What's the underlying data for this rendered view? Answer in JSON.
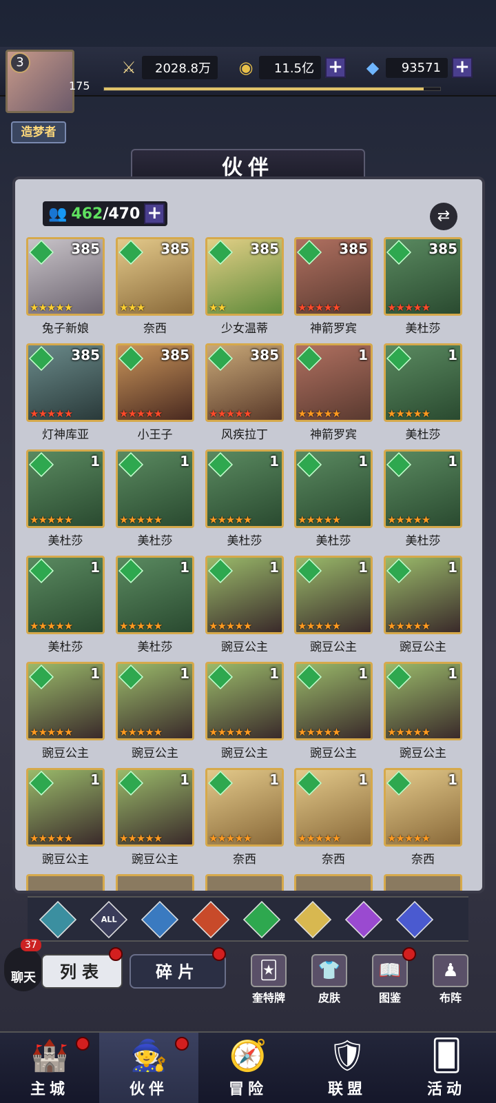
{
  "player": {
    "level": "3",
    "exp": "175",
    "exp_progress": 0.95,
    "title": "造梦者"
  },
  "resources": [
    {
      "icon": "sword-icon",
      "value": "2028.8万"
    },
    {
      "icon": "gold-coin-icon",
      "value": "11.5亿"
    },
    {
      "icon": "diamond-icon",
      "value": "93571"
    }
  ],
  "page_title": "伙伴",
  "partner_count": {
    "current": "462",
    "max": "/470"
  },
  "heroes": [
    {
      "name": "兔子新娘",
      "level": "385",
      "stars": 5,
      "star_color": "gold"
    },
    {
      "name": "奈西",
      "level": "385",
      "stars": 3,
      "star_color": "gold"
    },
    {
      "name": "少女温蒂",
      "level": "385",
      "stars": 2,
      "star_color": "gold"
    },
    {
      "name": "神箭罗宾",
      "level": "385",
      "stars": 5,
      "star_color": "red"
    },
    {
      "name": "美杜莎",
      "level": "385",
      "stars": 5,
      "star_color": "red"
    },
    {
      "name": "灯神库亚",
      "level": "385",
      "stars": 5,
      "star_color": "red"
    },
    {
      "name": "小王子",
      "level": "385",
      "stars": 5,
      "star_color": "red"
    },
    {
      "name": "风疾拉丁",
      "level": "385",
      "stars": 5,
      "star_color": "red"
    },
    {
      "name": "神箭罗宾",
      "level": "1",
      "stars": 5,
      "star_color": "orange"
    },
    {
      "name": "美杜莎",
      "level": "1",
      "stars": 5,
      "star_color": "orange"
    },
    {
      "name": "美杜莎",
      "level": "1",
      "stars": 5,
      "star_color": "orange"
    },
    {
      "name": "美杜莎",
      "level": "1",
      "stars": 5,
      "star_color": "orange"
    },
    {
      "name": "美杜莎",
      "level": "1",
      "stars": 5,
      "star_color": "orange"
    },
    {
      "name": "美杜莎",
      "level": "1",
      "stars": 5,
      "star_color": "orange"
    },
    {
      "name": "美杜莎",
      "level": "1",
      "stars": 5,
      "star_color": "orange"
    },
    {
      "name": "美杜莎",
      "level": "1",
      "stars": 5,
      "star_color": "orange"
    },
    {
      "name": "美杜莎",
      "level": "1",
      "stars": 5,
      "star_color": "orange"
    },
    {
      "name": "豌豆公主",
      "level": "1",
      "stars": 5,
      "star_color": "orange"
    },
    {
      "name": "豌豆公主",
      "level": "1",
      "stars": 5,
      "star_color": "orange"
    },
    {
      "name": "豌豆公主",
      "level": "1",
      "stars": 5,
      "star_color": "orange"
    },
    {
      "name": "豌豆公主",
      "level": "1",
      "stars": 5,
      "star_color": "orange"
    },
    {
      "name": "豌豆公主",
      "level": "1",
      "stars": 5,
      "star_color": "orange"
    },
    {
      "name": "豌豆公主",
      "level": "1",
      "stars": 5,
      "star_color": "orange"
    },
    {
      "name": "豌豆公主",
      "level": "1",
      "stars": 5,
      "star_color": "orange"
    },
    {
      "name": "豌豆公主",
      "level": "1",
      "stars": 5,
      "star_color": "orange"
    },
    {
      "name": "豌豆公主",
      "level": "1",
      "stars": 5,
      "star_color": "orange"
    },
    {
      "name": "豌豆公主",
      "level": "1",
      "stars": 5,
      "star_color": "orange"
    },
    {
      "name": "奈西",
      "level": "1",
      "stars": 5,
      "star_color": "orange"
    },
    {
      "name": "奈西",
      "level": "1",
      "stars": 5,
      "star_color": "orange"
    },
    {
      "name": "奈西",
      "level": "1",
      "stars": 5,
      "star_color": "orange"
    }
  ],
  "filters": [
    {
      "icon": "arrow-up-icon",
      "label": ""
    },
    {
      "icon": "all-icon",
      "label": "ALL"
    },
    {
      "icon": "water-drop-icon",
      "label": ""
    },
    {
      "icon": "fire-icon",
      "label": ""
    },
    {
      "icon": "wind-icon",
      "label": ""
    },
    {
      "icon": "light-icon",
      "label": ""
    },
    {
      "icon": "moon-icon",
      "label": ""
    },
    {
      "icon": "planet-icon",
      "label": ""
    }
  ],
  "chat": {
    "label": "聊天",
    "badge": "37"
  },
  "tabs": {
    "list": "列表",
    "fragments": "碎片"
  },
  "side_buttons": [
    {
      "label": "奎特牌",
      "icon": "card-icon"
    },
    {
      "label": "皮肤",
      "icon": "outfit-icon"
    },
    {
      "label": "图鉴",
      "icon": "book-icon"
    },
    {
      "label": "布阵",
      "icon": "formation-icon"
    }
  ],
  "nav": [
    {
      "label": "主城",
      "icon": "castle-icon"
    },
    {
      "label": "伙伴",
      "icon": "witch-hat-icon"
    },
    {
      "label": "冒险",
      "icon": "compass-icon"
    },
    {
      "label": "联盟",
      "icon": "shield-icon"
    },
    {
      "label": "活动",
      "icon": "cards-icon"
    }
  ]
}
